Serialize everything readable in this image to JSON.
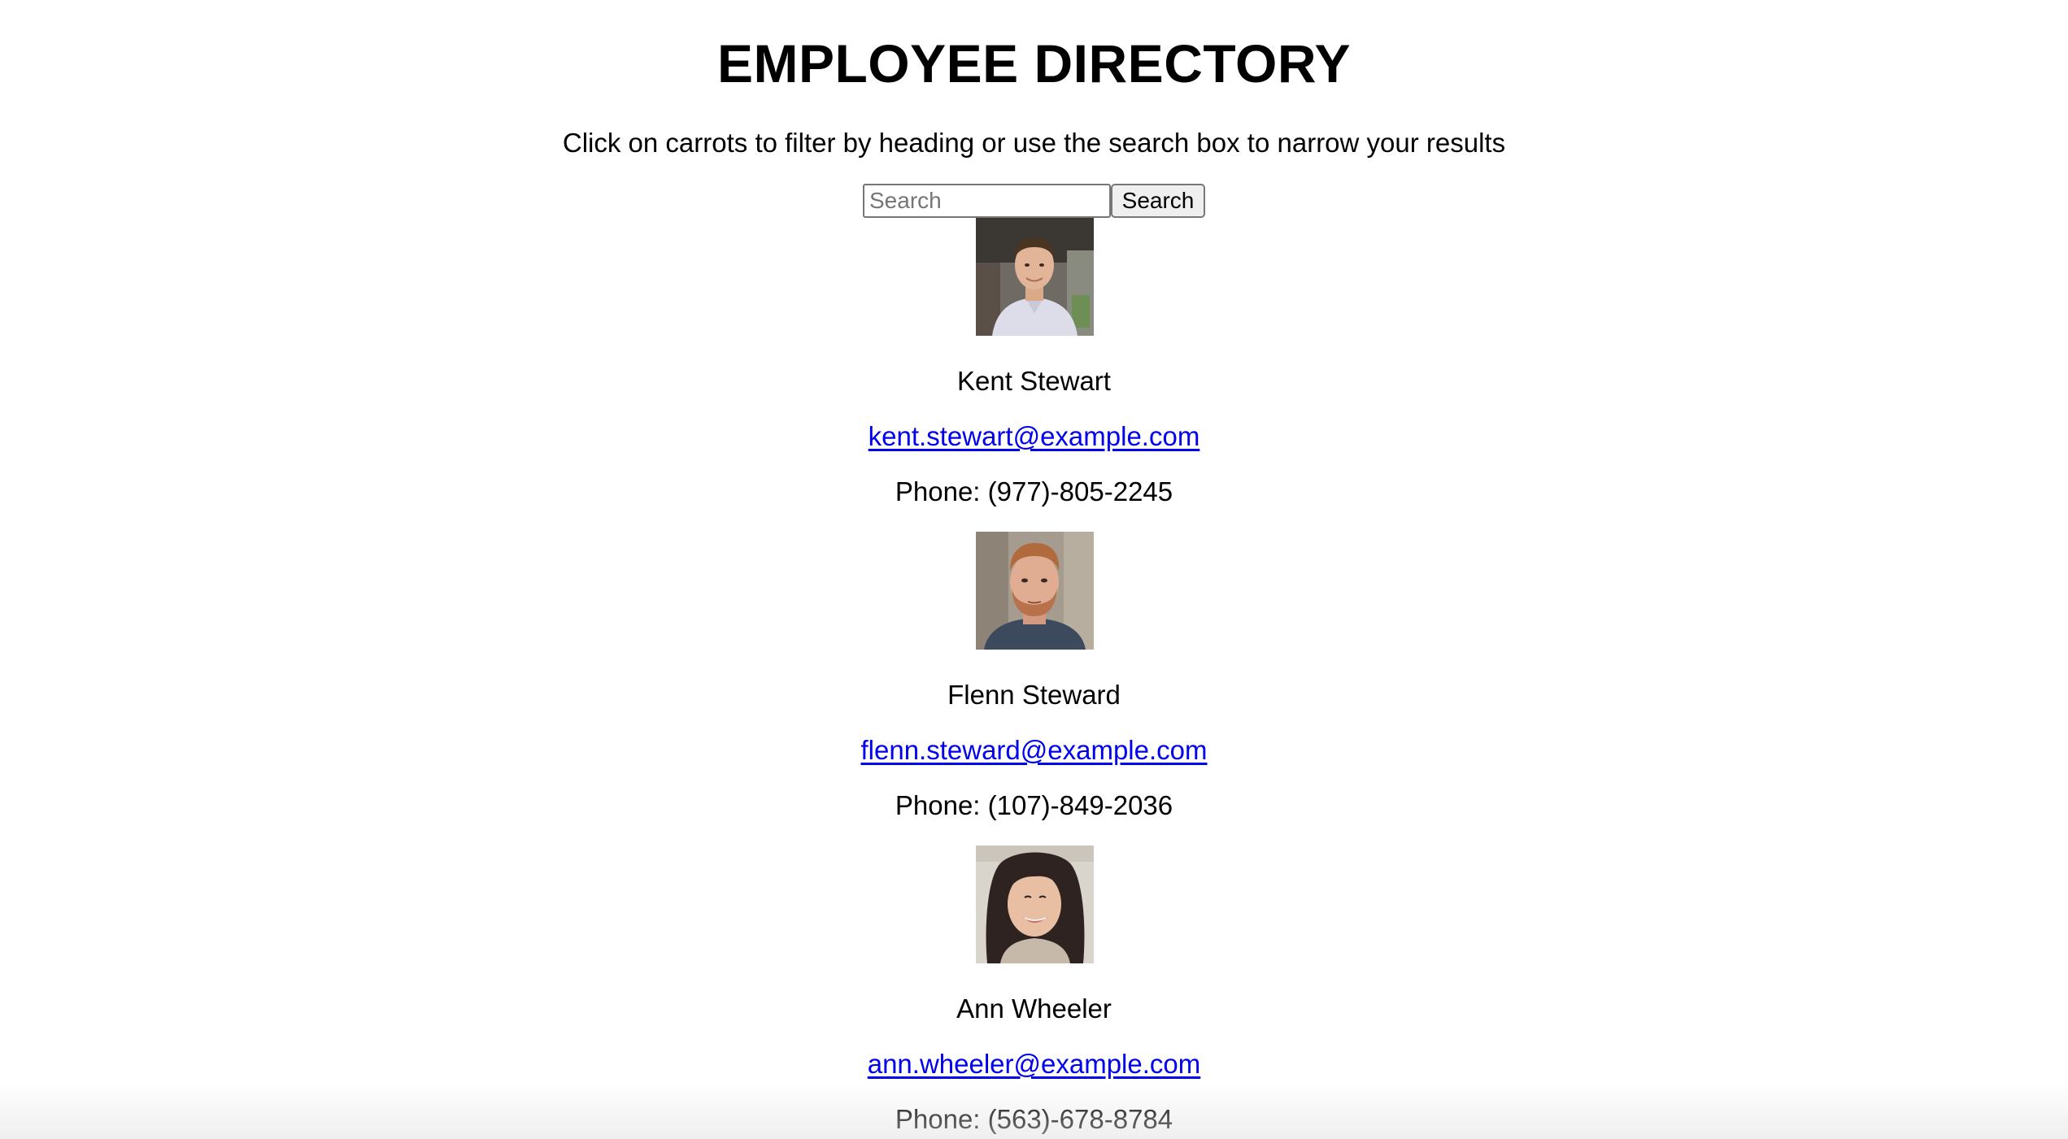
{
  "header": {
    "title": "EMPLOYEE DIRECTORY",
    "instructions": "Click on carrots to filter by heading or use the search box to narrow your results"
  },
  "search": {
    "placeholder": "Search",
    "value": "",
    "button_label": "Search"
  },
  "employees": [
    {
      "name": "Kent Stewart",
      "email": "kent.stewart@example.com",
      "phone": "Phone: (977)-805-2245",
      "photo": "employee-photo"
    },
    {
      "name": "Flenn Steward",
      "email": "flenn.steward@example.com",
      "phone": "Phone: (107)-849-2036",
      "photo": "employee-photo"
    },
    {
      "name": "Ann Wheeler",
      "email": "ann.wheeler@example.com",
      "phone": "Phone: (563)-678-8784",
      "photo": "employee-photo"
    }
  ],
  "colors": {
    "link": "#0000ee",
    "text": "#000000",
    "background": "#ffffff"
  }
}
